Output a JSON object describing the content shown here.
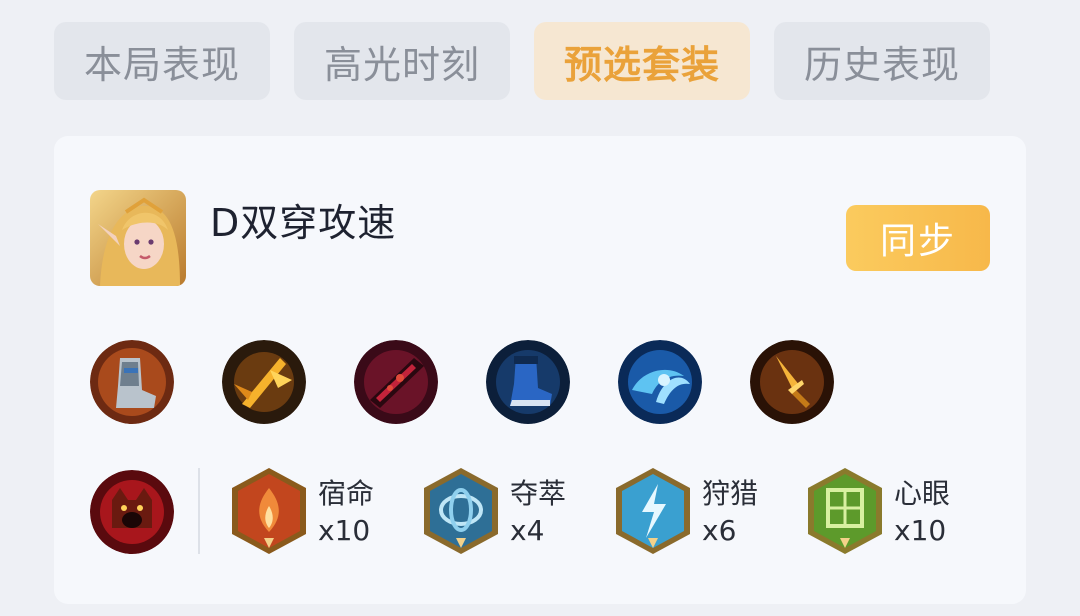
{
  "tabs": [
    {
      "label": "本局表现",
      "active": false
    },
    {
      "label": "高光时刻",
      "active": false
    },
    {
      "label": "预选套装",
      "active": true
    },
    {
      "label": "历史表现",
      "active": false
    }
  ],
  "set": {
    "title": "D双穿攻速",
    "hero_icon": "elf-hero-portrait",
    "sync_label": "同步"
  },
  "equipment": [
    {
      "icon": "armored-boots-icon"
    },
    {
      "icon": "golden-blade-icon"
    },
    {
      "icon": "crimson-blade-icon"
    },
    {
      "icon": "blue-boots-icon"
    },
    {
      "icon": "water-orb-icon"
    },
    {
      "icon": "golden-dagger-icon"
    }
  ],
  "skill": {
    "icon": "red-beast-skill-icon"
  },
  "runes": [
    {
      "name": "宿命",
      "count": "x10",
      "icon": "flame-rune-icon",
      "color": "#d9532a"
    },
    {
      "name": "夺萃",
      "count": "x4",
      "icon": "knot-rune-icon",
      "color": "#4a9ac0"
    },
    {
      "name": "狩猎",
      "count": "x6",
      "icon": "lightning-rune-icon",
      "color": "#3fa7d8"
    },
    {
      "name": "心眼",
      "count": "x10",
      "icon": "eye-rune-icon",
      "color": "#5d9a2b"
    }
  ],
  "colors": {
    "accent": "#eaa23a",
    "sync_button": "#f7b84a",
    "page_bg": "#eef0f5",
    "card_bg": "#f6f8fc"
  }
}
